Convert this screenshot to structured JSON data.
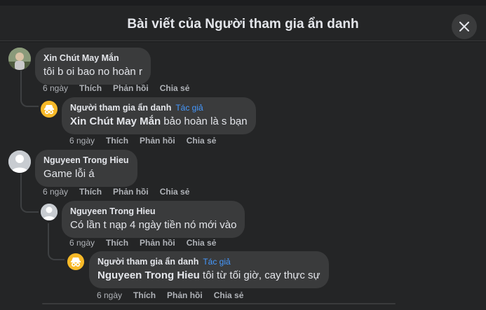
{
  "header": {
    "title": "Bài viết của Người tham gia ẩn danh"
  },
  "labels": {
    "like": "Thích",
    "reply": "Phản hồi",
    "share": "Chia sẻ",
    "author_badge": "Tác giả"
  },
  "comments": [
    {
      "author": "Xin Chút May Mắn",
      "text": "tôi b oi bao no hoàn r",
      "time": "6 ngày"
    },
    {
      "author": "Người tham gia ẩn danh",
      "mention": "Xin Chút May Mắn",
      "text": " bảo hoàn là s bạn",
      "time": "6 ngày"
    },
    {
      "author": "Nguyeen Trong Hieu",
      "text": "Game lỗi á",
      "time": "6 ngày"
    },
    {
      "author": "Nguyeen Trong Hieu",
      "text": "Có lần t nạp 4 ngày tiền nó mới vào",
      "time": "6 ngày"
    },
    {
      "author": "Người tham gia ẩn danh",
      "mention": "Nguyeen Trong Hieu",
      "text": " tôi từ tối giờ, cay thực sự",
      "time": "6 ngày"
    }
  ],
  "colors": {
    "background": "#242526",
    "bubble": "#3a3b3c",
    "author_badge": "#4599ff",
    "anon_avatar": "#f7b928"
  }
}
